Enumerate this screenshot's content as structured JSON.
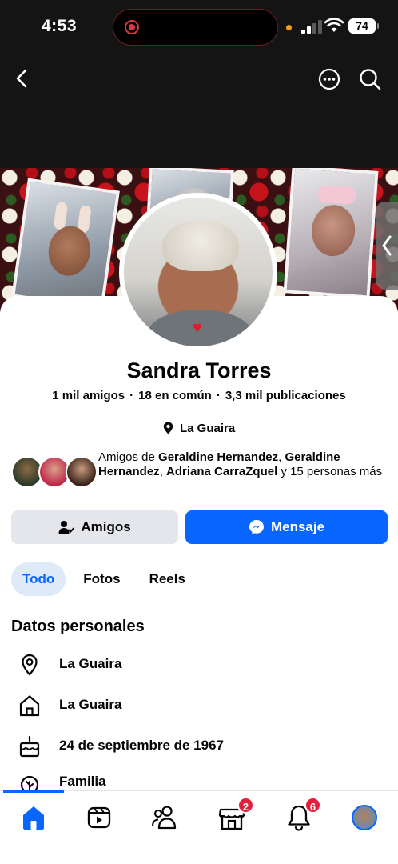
{
  "status_bar": {
    "time": "4:53",
    "battery": "74"
  },
  "top_nav": {
    "back_icon": "chevron-left-icon",
    "more_icon": "more-horizontal-icon",
    "search_icon": "search-icon"
  },
  "profile": {
    "name": "Sandra Torres",
    "friends": "1 mil amigos",
    "mutual": "18 en común",
    "posts": "3,3 mil publicaciones",
    "separator": "·",
    "location": "La Guaira"
  },
  "mutual_friends": {
    "prefix": "Amigos de ",
    "name1": "Geraldine Hernandez",
    "comma1": ", ",
    "name2": "Geraldine Hernandez",
    "comma2": ", ",
    "name3": "Adriana CarraZquel",
    "suffix": " y 15 personas más"
  },
  "actions": {
    "friends_label": "Amigos",
    "message_label": "Mensaje"
  },
  "tabs": [
    {
      "label": "Todo",
      "active": true
    },
    {
      "label": "Fotos"
    },
    {
      "label": "Reels"
    }
  ],
  "personal_info": {
    "title": "Datos personales",
    "items": [
      {
        "icon": "location-pin-icon",
        "text": "La Guaira"
      },
      {
        "icon": "home-icon",
        "text": "La Guaira"
      },
      {
        "icon": "birthday-cake-icon",
        "text": "24 de septiembre de 1967"
      },
      {
        "icon": "family-icon",
        "text": "Familia"
      }
    ]
  },
  "bottom_nav": {
    "items": [
      "home-icon",
      "video-icon",
      "friends-icon",
      "marketplace-icon",
      "notifications-icon",
      "profile-avatar"
    ],
    "marketplace_badge": "2",
    "notifications_badge": "6"
  },
  "colors": {
    "accent": "#0866ff",
    "badge": "#e41e3f",
    "button_gray": "#e4e6eb",
    "tab_active_bg": "#dfeaf8"
  }
}
